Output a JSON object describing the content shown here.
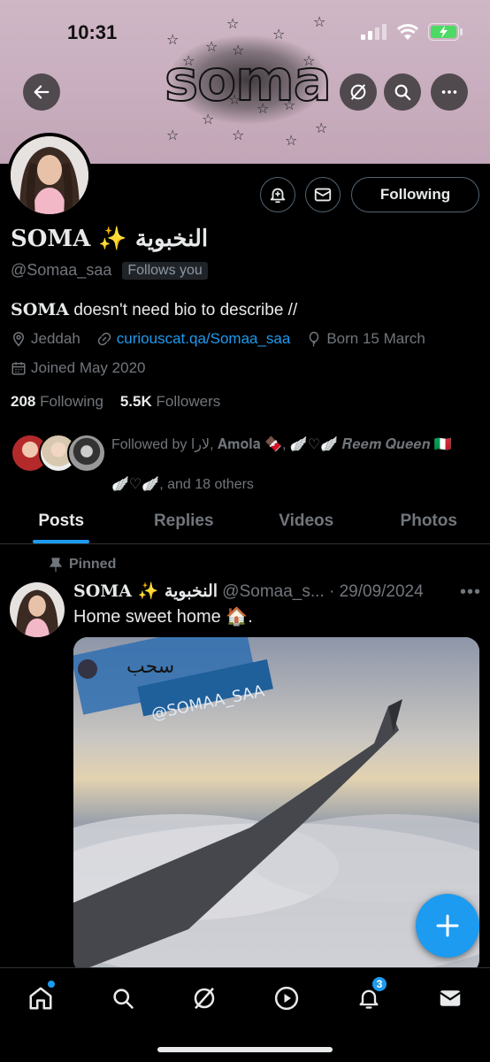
{
  "status_bar": {
    "time": "10:31"
  },
  "banner": {
    "logo_text": "soma"
  },
  "profile": {
    "display_name": "SOMA ✨ النخبوية",
    "handle": "@Somaa_saa",
    "follows_you": "Follows you",
    "follow_button": "Following",
    "bio_name": "SOMA",
    "bio_text": " doesn't need bio to describe //",
    "location": "Jeddah",
    "link": "curiouscat.qa/Somaa_saa",
    "birthday": "Born 15 March",
    "joined": "Joined May 2020",
    "following_count": "208",
    "following_label": "Following",
    "followers_count": "5.5K",
    "followers_label": "Followers",
    "followed_by_line1": "Followed by لارا, 𝐀𝐦𝐨𝐥𝐚 🍫, 🪽♡🪽 𝑹𝒆𝒆𝒎 𝑸𝒖𝒆𝒆𝒏 🇮🇹",
    "followed_by_line2": "🪽♡🪽, and 18 others"
  },
  "tabs": [
    {
      "label": "Posts",
      "active": true
    },
    {
      "label": "Replies",
      "active": false
    },
    {
      "label": "Videos",
      "active": false
    },
    {
      "label": "Photos",
      "active": false
    }
  ],
  "post": {
    "pinned_label": "Pinned",
    "author": "SOMA ✨ النخبوية",
    "handle_date": " @Somaa_s... · 29/09/2024",
    "text": "Home sweet home 🏠.",
    "overlay_arabic": "سحب",
    "overlay_tag": "@SOMAA_SAA"
  },
  "bottom_nav": {
    "notifications_badge": "3"
  },
  "colors": {
    "accent": "#1d9bf0",
    "background": "#000000",
    "banner": "#c9afc0",
    "muted_text": "#71767b"
  }
}
